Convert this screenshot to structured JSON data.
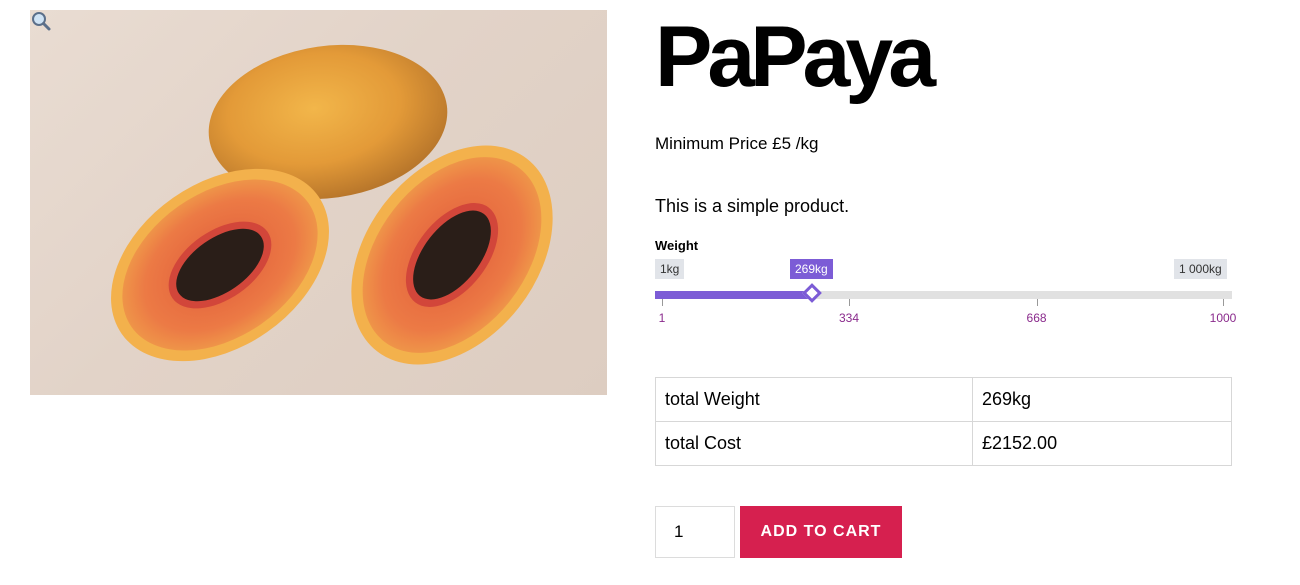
{
  "product": {
    "title": "PaPaya",
    "min_price": "Minimum Price £5 /kg",
    "short_description": "This is a simple product.",
    "image_icon": "zoom-magnifier-icon"
  },
  "weight_slider": {
    "label": "Weight",
    "min_label": "1kg",
    "max_label": "1 000kg",
    "value_label": "269kg",
    "value": 269,
    "min": 1,
    "max": 1000,
    "ticks": [
      "1",
      "334",
      "668",
      "1000"
    ],
    "accent_color": "#7c5cd6"
  },
  "totals": {
    "rows": [
      {
        "label": "total Weight",
        "value": "269kg"
      },
      {
        "label": "total Cost",
        "value": "£2152.00"
      }
    ]
  },
  "cart": {
    "quantity": "1",
    "button_label": "ADD TO CART",
    "button_color": "#d6204f"
  }
}
